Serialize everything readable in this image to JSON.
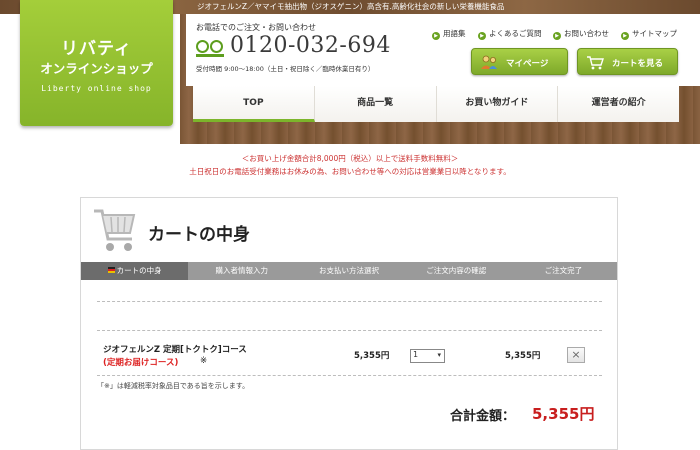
{
  "header": {
    "tagline": "ジオフェルンZ／ヤマイモ抽出物（ジオスゲニン）高含有.高齢化社会の新しい栄養機能食品",
    "logo": {
      "line1": "リバティ",
      "line2": "オンラインショップ",
      "line3": "Liberty online shop"
    },
    "phone_label": "お電話でのご注文・お問い合わせ",
    "phone_number": "0120-032-694",
    "hours": "受付時間 9:00～18:00（土日・祝日除く／臨時休業日有り）",
    "util_links": [
      "用語集",
      "よくあるご質問",
      "お問い合わせ",
      "サイトマップ"
    ],
    "mypage_label": "マイページ",
    "cart_label": "カートを見る"
  },
  "nav": {
    "tabs": [
      "TOP",
      "商品一覧",
      "お買い物ガイド",
      "運営者の紹介"
    ]
  },
  "notices": {
    "shipping": "＜お買い上げ金額合計8,000円（税込）以上で送料手数料無料＞",
    "weekend": "土日祝日のお電話受付業務はお休みの為、お問い合わせ等への対応は営業業日以降となります。"
  },
  "cart": {
    "title": "カートの中身",
    "steps": [
      "カートの中身",
      "購入者情報入力",
      "お支払い方法選択",
      "ご注文内容の確認",
      "ご注文完了"
    ],
    "item": {
      "name": "ジオフェルンZ 定期[トクトク]コース",
      "sub": "(定期お届けコース)",
      "mark": "※",
      "price": "5,355円",
      "qty": "1",
      "subtotal": "5,355円",
      "delete": "×"
    },
    "tax_note": "「※」は軽減税率対象品目である旨を示します。",
    "total_label": "合計金額：",
    "total_value": "5,355円"
  },
  "colors": {
    "accent_green": "#86b42a",
    "price_red": "#c81e1e",
    "wood": "#7a5535"
  },
  "icons": {
    "cart": "shopping-cart-icon",
    "mypage": "user-icon",
    "cart_button": "cart-icon",
    "link": "arrow-circle-icon"
  }
}
